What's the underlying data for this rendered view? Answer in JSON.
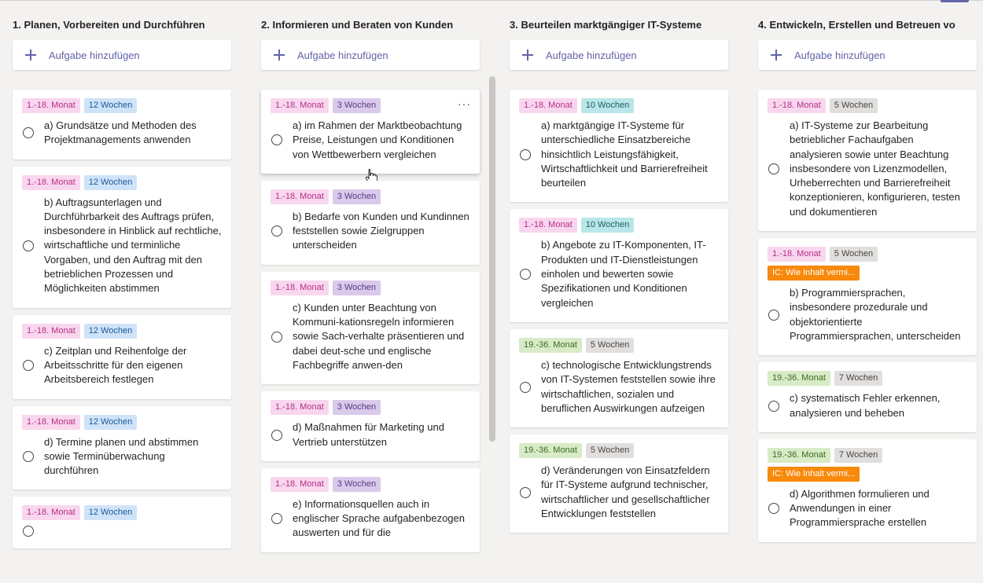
{
  "add_label": "Aufgabe hinzufügen",
  "columns": [
    {
      "title": "1. Planen, Vorbereiten und Durchführen",
      "cards": [
        {
          "labels": [
            {
              "text": "1.-18. Monat",
              "color": "pink"
            },
            {
              "text": "12 Wochen",
              "color": "blue"
            }
          ],
          "text": "a) Grundsätze und Methoden des Projektmanagements anwenden"
        },
        {
          "labels": [
            {
              "text": "1.-18. Monat",
              "color": "pink"
            },
            {
              "text": "12 Wochen",
              "color": "blue"
            }
          ],
          "text": "b) Auftragsunterlagen und Durchführbarkeit des Auftrags prüfen, insbesondere in Hinblick auf rechtliche, wirtschaftliche und terminliche Vorgaben, und den Auftrag mit den betrieblichen Prozessen und Möglichkeiten abstimmen"
        },
        {
          "labels": [
            {
              "text": "1.-18. Monat",
              "color": "pink"
            },
            {
              "text": "12 Wochen",
              "color": "blue"
            }
          ],
          "text": "c) Zeitplan und Reihenfolge der Arbeitsschritte für den eigenen Arbeitsbereich festlegen"
        },
        {
          "labels": [
            {
              "text": "1.-18. Monat",
              "color": "pink"
            },
            {
              "text": "12 Wochen",
              "color": "blue"
            }
          ],
          "text": "d) Termine planen und abstimmen sowie Terminüberwachung durchführen"
        },
        {
          "labels": [
            {
              "text": "1.-18. Monat",
              "color": "pink"
            },
            {
              "text": "12 Wochen",
              "color": "blue"
            }
          ],
          "text": ""
        }
      ]
    },
    {
      "title": "2. Informieren und Beraten von Kunden",
      "cards": [
        {
          "labels": [
            {
              "text": "1.-18. Monat",
              "color": "pink"
            },
            {
              "text": "3 Wochen",
              "color": "purple"
            }
          ],
          "text": "a) im Rahmen der Marktbeobachtung Preise, Leistungen und Konditionen von Wettbewerbern vergleichen",
          "more": "···"
        },
        {
          "labels": [
            {
              "text": "1.-18. Monat",
              "color": "pink"
            },
            {
              "text": "3 Wochen",
              "color": "purple"
            }
          ],
          "text": "b) Bedarfe von Kunden und Kundinnen feststellen sowie Zielgruppen unterscheiden"
        },
        {
          "labels": [
            {
              "text": "1.-18. Monat",
              "color": "pink"
            },
            {
              "text": "3 Wochen",
              "color": "purple"
            }
          ],
          "text": "c) Kunden unter Beachtung von Kommuni-kationsregeln informieren sowie Sach-verhalte präsentieren und dabei deut-sche und englische Fachbegriffe anwen-den"
        },
        {
          "labels": [
            {
              "text": "1.-18. Monat",
              "color": "pink"
            },
            {
              "text": "3 Wochen",
              "color": "purple"
            }
          ],
          "text": "d) Maßnahmen für Marketing und Vertrieb unterstützen"
        },
        {
          "labels": [
            {
              "text": "1.-18. Monat",
              "color": "pink"
            },
            {
              "text": "3 Wochen",
              "color": "purple"
            }
          ],
          "text": "e) Informationsquellen auch in englischer Sprache aufgabenbezogen auswerten und für die"
        }
      ]
    },
    {
      "title": "3. Beurteilen marktgängiger IT-Systeme",
      "cards": [
        {
          "labels": [
            {
              "text": "1.-18. Monat",
              "color": "pink"
            },
            {
              "text": "10 Wochen",
              "color": "teal"
            }
          ],
          "text": "a) marktgängige IT-Systeme für unterschiedliche Einsatzbereiche hinsichtlich Leistungsfähigkeit, Wirtschaftlichkeit und Barrierefreiheit beurteilen"
        },
        {
          "labels": [
            {
              "text": "1.-18. Monat",
              "color": "pink"
            },
            {
              "text": "10 Wochen",
              "color": "teal"
            }
          ],
          "text": "b) Angebote zu IT-Komponenten, IT-Produkten und IT-Dienstleistungen einholen und bewerten sowie Spezifikationen und Konditionen vergleichen"
        },
        {
          "labels": [
            {
              "text": "19.-36. Monat",
              "color": "green"
            },
            {
              "text": "5 Wochen",
              "color": "gray"
            }
          ],
          "text": "c) technologische Entwicklungstrends von IT-Systemen feststellen sowie ihre wirtschaftlichen, sozialen und beruflichen Auswirkungen aufzeigen"
        },
        {
          "labels": [
            {
              "text": "19.-36. Monat",
              "color": "green"
            },
            {
              "text": "5 Wochen",
              "color": "gray"
            }
          ],
          "text": "d) Veränderungen von Einsatzfeldern für IT-Systeme aufgrund technischer, wirtschaftlicher und gesellschaftlicher Entwicklungen feststellen"
        }
      ]
    },
    {
      "title": "4. Entwickeln, Erstellen und Betreuen vo",
      "cards": [
        {
          "labels": [
            {
              "text": "1.-18. Monat",
              "color": "pink"
            },
            {
              "text": "5 Wochen",
              "color": "gray"
            }
          ],
          "text": "a) IT-Systeme zur Bearbeitung betrieblicher Fachaufgaben analysieren sowie unter Beachtung insbesondere von Lizenzmodellen, Urheberrechten und Barrierefreiheit konzeptionieren, konfigurieren, testen und dokumentieren"
        },
        {
          "labels": [
            {
              "text": "1.-18. Monat",
              "color": "pink"
            },
            {
              "text": "5 Wochen",
              "color": "gray"
            },
            {
              "text": "IC: Wie Inhalt vermi...",
              "color": "orange"
            }
          ],
          "text": "b) Programmiersprachen, insbesondere prozedurale und objektorientierte Programmiersprachen, unterscheiden"
        },
        {
          "labels": [
            {
              "text": "19.-36. Monat",
              "color": "green"
            },
            {
              "text": "7 Wochen",
              "color": "gray"
            }
          ],
          "text": "c) systematisch Fehler erkennen, analysieren und beheben"
        },
        {
          "labels": [
            {
              "text": "19.-36. Monat",
              "color": "green"
            },
            {
              "text": "7 Wochen",
              "color": "gray"
            },
            {
              "text": "IC: Wie Inhalt vermi...",
              "color": "orange"
            }
          ],
          "text": "d) Algorithmen formulieren und Anwendungen in einer Programmiersprache erstellen"
        }
      ]
    }
  ]
}
